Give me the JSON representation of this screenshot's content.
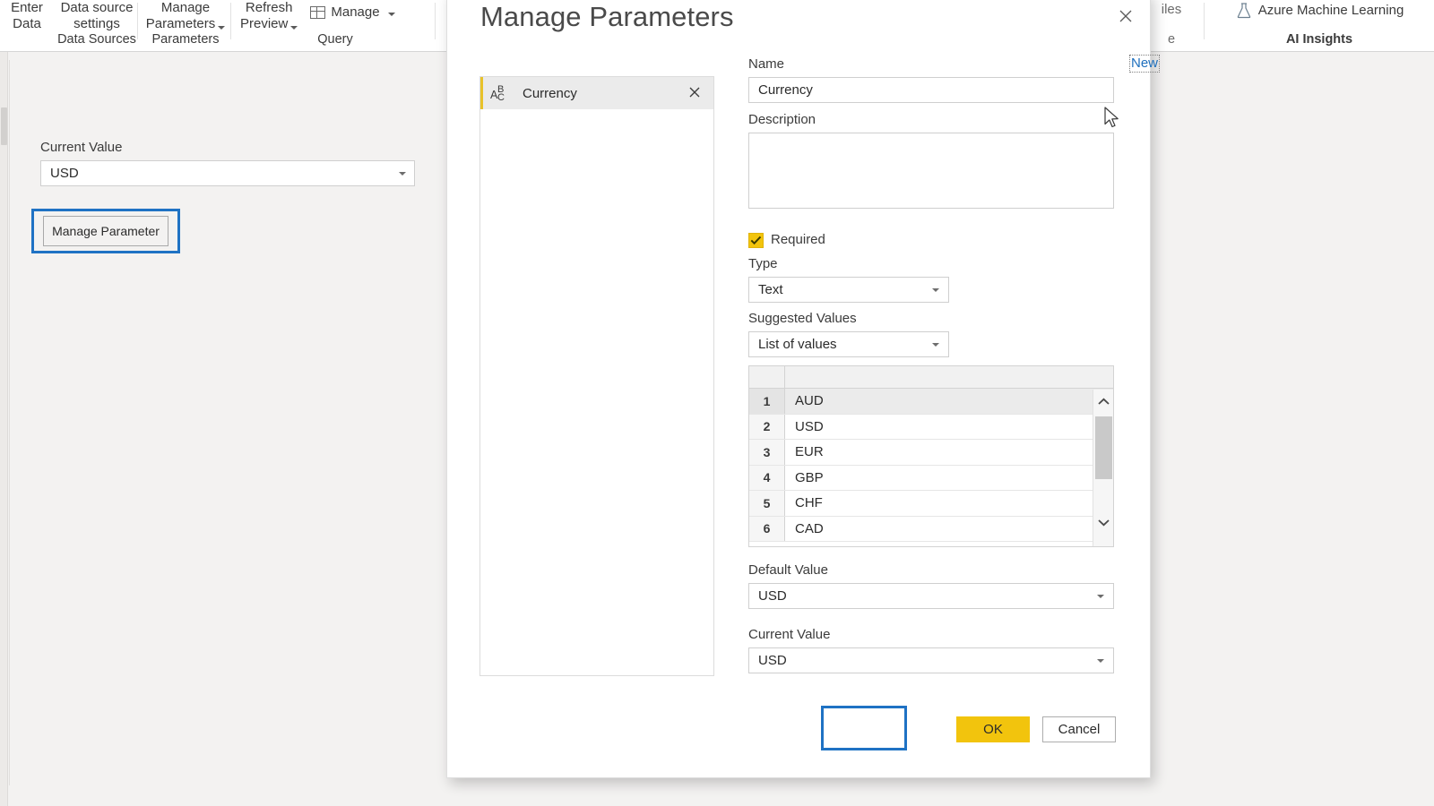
{
  "ribbon": {
    "groups": [
      {
        "button_lines": [
          "Enter",
          "Data"
        ],
        "label": "",
        "icon": "",
        "has_caret": false
      },
      {
        "button_lines": [
          "Data source",
          "settings"
        ],
        "label": "Data Sources",
        "icon": "",
        "has_caret": false
      },
      {
        "button_lines": [
          "Manage",
          "Parameters"
        ],
        "label": "Parameters",
        "icon": "",
        "has_caret": true
      },
      {
        "button_lines": [
          "Refresh",
          "Preview"
        ],
        "label": "",
        "icon": "",
        "has_caret": true
      },
      {
        "button_lines": [
          "Manage"
        ],
        "label": "Query",
        "icon": "grid-icon",
        "has_caret": true
      },
      {
        "button_lines": [
          "iles"
        ],
        "label": "e",
        "icon": "",
        "has_caret": false
      },
      {
        "button_lines": [
          "Azure Machine Learning"
        ],
        "label": "AI Insights",
        "icon": "flask-icon",
        "has_caret": false
      }
    ]
  },
  "background_pane": {
    "current_value_label": "Current Value",
    "current_value": "USD",
    "manage_parameter_button": "Manage Parameter",
    "dropdown_icon": "chevron-down-icon"
  },
  "dialog": {
    "title": "Manage Parameters",
    "close_icon": "close-icon",
    "new_link": "New",
    "parameters": [
      {
        "name": "Currency",
        "type_icon": "abc-text-type-icon",
        "selected": true,
        "delete_icon": "close-icon"
      }
    ],
    "form": {
      "name_label": "Name",
      "name_value": "Currency",
      "description_label": "Description",
      "description_value": "",
      "required_label": "Required",
      "required_checked": true,
      "type_label": "Type",
      "type_value": "Text",
      "suggested_values_label": "Suggested Values",
      "suggested_values_value": "List of values",
      "values_grid": {
        "rows": [
          {
            "index": "1",
            "value": "AUD"
          },
          {
            "index": "2",
            "value": "USD"
          },
          {
            "index": "3",
            "value": "EUR"
          },
          {
            "index": "4",
            "value": "GBP"
          },
          {
            "index": "5",
            "value": "CHF"
          },
          {
            "index": "6",
            "value": "CAD"
          }
        ],
        "selected_index": 0,
        "scroll_up_icon": "chevron-up-icon",
        "scroll_down_icon": "chevron-down-icon"
      },
      "default_value_label": "Default Value",
      "default_value": "USD",
      "current_value_label": "Current Value",
      "current_value": "USD"
    },
    "buttons": {
      "ok": "OK",
      "cancel": "Cancel"
    }
  },
  "annotations": {
    "highlight_color": "#1f72c4",
    "accent_yellow": "#f2c40d",
    "link_blue": "#1e6fbd"
  },
  "cursor": {
    "icon": "mouse-pointer-icon"
  }
}
